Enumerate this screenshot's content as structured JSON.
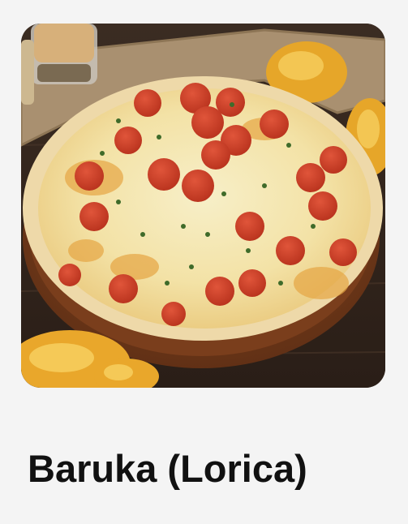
{
  "product": {
    "name": "Baruka (Lorica)",
    "image_icon": "pizza-photo"
  },
  "colors": {
    "background": "#f4f4f4",
    "title": "#111111"
  }
}
